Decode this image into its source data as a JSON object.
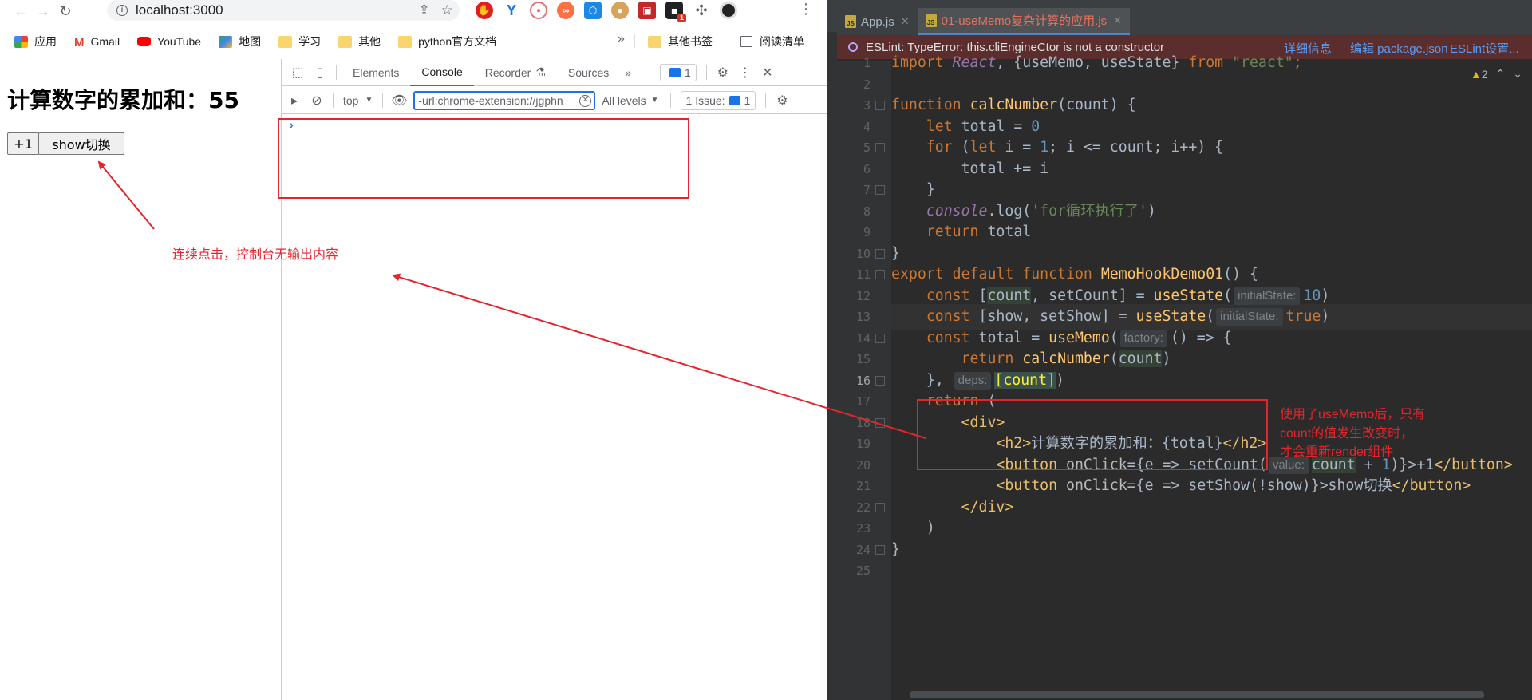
{
  "browser": {
    "url": "localhost:3000",
    "bookmarks": [
      "应用",
      "Gmail",
      "YouTube",
      "地图",
      "学习",
      "其他",
      "python官方文档"
    ],
    "bookmarks_more": "»",
    "other_bookmarks": "其他书签",
    "reading_list": "阅读清单",
    "extension_badge": "1"
  },
  "page": {
    "heading": "计算数字的累加和：55",
    "increment_button": "+1",
    "toggle_button": "show切换"
  },
  "devtools": {
    "tabs": [
      "Elements",
      "Console",
      "Recorder",
      "Sources"
    ],
    "active_tab": "Console",
    "tabs_more": "»",
    "message_count": "1",
    "context": "top",
    "filter_value": "-url:chrome-extension://jgphn",
    "levels": "All levels",
    "issues_label": "1 Issue:",
    "issues_count": "1",
    "prompt": "›"
  },
  "annotations": {
    "console_note": "连续点击，控制台无输出内容",
    "usememo_note_line1": "使用了useMemo后，只有",
    "usememo_note_line2": "count的值发生改变时，",
    "usememo_note_line3": "才会重新render组件",
    "color": "#e4262c"
  },
  "ide": {
    "tabs": [
      "App.js",
      "01-useMemo复杂计算的应用.js"
    ],
    "active_tab_index": 1,
    "eslint_error": "ESLint: TypeError: this.cliEngineCtor is not a constructor",
    "eslint_links": [
      "详细信息",
      "编辑 package.json",
      "ESLint设置..."
    ],
    "warning_count": "2",
    "current_line": 16,
    "line_numbers": [
      1,
      2,
      3,
      4,
      5,
      6,
      7,
      8,
      9,
      10,
      11,
      12,
      13,
      14,
      15,
      16,
      17,
      18,
      19,
      20,
      21,
      22,
      23,
      24,
      25
    ],
    "hints": {
      "initial_state": "initialState:",
      "factory": "factory:",
      "deps": "deps:",
      "value": "value:"
    },
    "code": {
      "l1_import": "import",
      "l1_react": "React",
      "l1_named": ", {useMemo, useState} ",
      "l1_from": "from",
      "l1_module": "\"react\"",
      "l1_end": ";",
      "l3_function": "function",
      "l3_name": "calcNumber",
      "l3_params": "(count) {",
      "l4_let": "let",
      "l4_rest": " total = ",
      "l4_zero": "0",
      "l5_for": "for",
      "l5_a": " (",
      "l5_let": "let",
      "l5_b": " i = ",
      "l5_one": "1",
      "l5_c": "; i <= count; i++) {",
      "l6": "total += i",
      "l7": "}",
      "l8_console": "console",
      "l8_log": ".log(",
      "l8_str": "'for循环执行了'",
      "l8_end": ")",
      "l9_return": "return",
      "l9_rest": " total",
      "l10": "}",
      "l11_export": "export default function",
      "l11_name": "MemoHookDemo01",
      "l11_rest": "() {",
      "l12_const": "const",
      "l12_a": " [",
      "l12_count": "count",
      "l12_b": ", setCount] = ",
      "l12_fn": "useState",
      "l12_c": "(",
      "l12_val": "10",
      "l12_d": ")",
      "l13_const": "const",
      "l13_a": " [show, setShow] = ",
      "l13_fn": "useState",
      "l13_b": "(",
      "l13_val": "true",
      "l13_c": ")",
      "l14_const": "const",
      "l14_a": " total = ",
      "l14_fn": "useMemo",
      "l14_b": "(",
      "l14_c": "() => {",
      "l15_return": "return",
      "l15_fn": "calcNumber",
      "l15_a": "(",
      "l15_count": "count",
      "l15_b": ")",
      "l16_a": "},",
      "l16_dep": "[count]",
      "l16_b": ")",
      "l17_return": "return",
      "l17_rest": " (",
      "l18": "<div>",
      "l19_open": "<h2>",
      "l19_text": "计算数字的累加和：{total}",
      "l19_close": "</h2>",
      "l20_open": "<button",
      "l20_attr": " onClick",
      "l20_a": "={e => setCount(",
      "l20_count": "count",
      "l20_b": " + ",
      "l20_one": "1",
      "l20_c": ")}>+1",
      "l20_close": "</button>",
      "l21_open": "<button",
      "l21_attr": " onClick",
      "l21_a": "={e => setShow(!show)}>show切换",
      "l21_close": "</button>",
      "l22": "</div>",
      "l23": ")",
      "l24": "}"
    }
  }
}
